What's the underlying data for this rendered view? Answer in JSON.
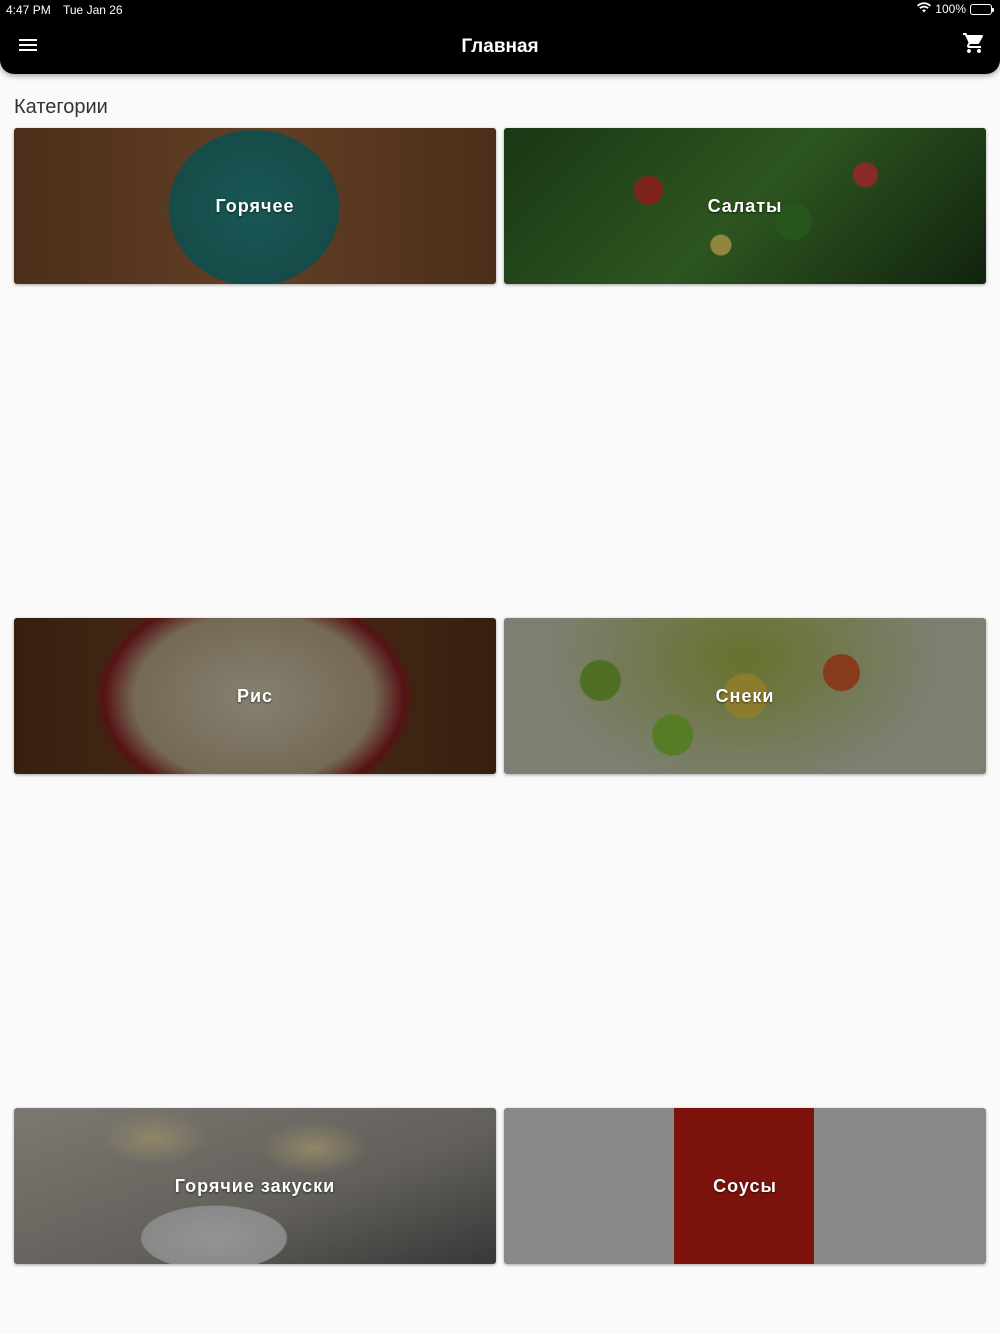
{
  "status_bar": {
    "time": "4:47 PM",
    "date": "Tue Jan 26",
    "battery": "100%"
  },
  "app_bar": {
    "title": "Главная",
    "menu_icon": "menu-icon",
    "cart_icon": "shopping-cart-icon"
  },
  "section_title": "Категории",
  "categories": [
    {
      "label": "Горячее"
    },
    {
      "label": "Салаты"
    },
    {
      "label": "Рис"
    },
    {
      "label": "Снеки"
    },
    {
      "label": "Горячие закуски"
    },
    {
      "label": "Соусы"
    }
  ]
}
